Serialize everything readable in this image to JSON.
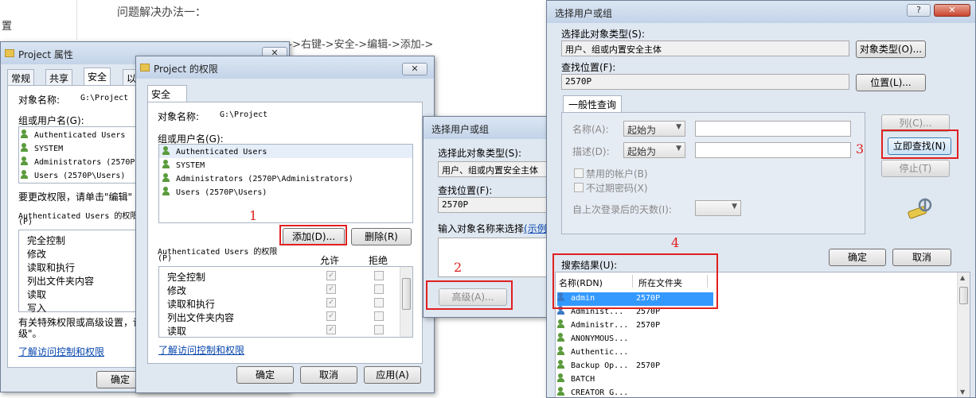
{
  "background": {
    "left_label": "置",
    "heading": "问题解决办法一：",
    "instruction": "...->右键->安全->编辑->添加->"
  },
  "project_props": {
    "title": "Project 属性",
    "close": "✕",
    "tabs": [
      "常规",
      "共享",
      "安全",
      "以"
    ],
    "object_label": "对象名称:",
    "object_value": "G:\\Project",
    "group_label": "组或用户名(G):",
    "users": [
      "Authenticated Users",
      "SYSTEM",
      "Administrators (2570P",
      "Users (2570P\\Users)"
    ],
    "change_text": "要更改权限，请单击\"编辑\"",
    "perm_label": "Authenticated Users 的权限",
    "perm_label2": "(P)",
    "perms": [
      "完全控制",
      "修改",
      "读取和执行",
      "列出文件夹内容",
      "读取",
      "写入"
    ],
    "special_text": "有关特殊权限或高级设置，请",
    "special_text2": "级\"。",
    "learn_link": "了解访问控制和权限",
    "ok": "确定"
  },
  "permissions": {
    "title": "Project 的权限",
    "close": "✕",
    "tab": "安全",
    "object_label": "对象名称:",
    "object_value": "G:\\Project",
    "group_label": "组或用户名(G):",
    "users": [
      "Authenticated Users",
      "SYSTEM",
      "Administrators (2570P\\Administrators)",
      "Users (2570P\\Users)"
    ],
    "add": "添加(D)...",
    "remove": "删除(R)",
    "perm_label": "Authenticated Users 的权限",
    "perm_label2": "(P)",
    "allow": "允许",
    "deny": "拒绝",
    "perms": [
      "完全控制",
      "修改",
      "读取和执行",
      "列出文件夹内容",
      "读取"
    ],
    "learn_link": "了解访问控制和权限",
    "ok": "确定",
    "cancel": "取消",
    "apply": "应用(A)"
  },
  "select_small": {
    "title": "选择用户或组",
    "type_label": "选择此对象类型(S):",
    "type_value": "用户、组或内置安全主体",
    "loc_label": "查找位置(F):",
    "loc_value": "2570P",
    "enter_label": "输入对象名称来选择",
    "examples": "(示例",
    "advanced": "高级(A)..."
  },
  "select_big": {
    "title": "选择用户或组",
    "help": "?",
    "close": "✕",
    "type_label": "选择此对象类型(S):",
    "type_value": "用户、组或内置安全主体",
    "type_btn": "对象类型(O)...",
    "loc_label": "查找位置(F):",
    "loc_value": "2570P",
    "loc_btn": "位置(L)...",
    "tab": "一般性查询",
    "name_label": "名称(A):",
    "desc_label": "描述(D):",
    "starts_with": "起始为",
    "disabled": "禁用的帐户(B)",
    "no_expire": "不过期密码(X)",
    "days": "自上次登录后的天数(I):",
    "columns_btn": "列(C)...",
    "find_btn": "立即查找(N)",
    "stop_btn": "停止(T)",
    "ok": "确定",
    "cancel": "取消",
    "results_label": "搜索结果(U):",
    "col_name": "名称(RDN)",
    "col_folder": "所在文件夹",
    "results": [
      {
        "name": "admin",
        "folder": "2570P"
      },
      {
        "name": "Administ...",
        "folder": "2570P"
      },
      {
        "name": "Administr...",
        "folder": "2570P"
      },
      {
        "name": "ANONYMOUS...",
        "folder": ""
      },
      {
        "name": "Authentic...",
        "folder": ""
      },
      {
        "name": "Backup Op...",
        "folder": "2570P"
      },
      {
        "name": "BATCH",
        "folder": ""
      },
      {
        "name": "CREATOR G...",
        "folder": ""
      }
    ]
  },
  "annotations": [
    "1",
    "2",
    "3",
    "4"
  ],
  "colors": {
    "annotation": "#e02020",
    "selection": "#3399ff",
    "link": "#0645ad"
  }
}
